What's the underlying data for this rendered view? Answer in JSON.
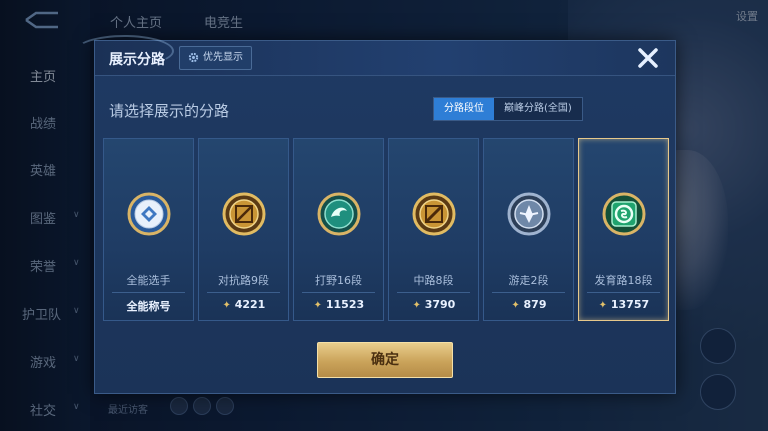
{
  "background": {
    "nav": [
      {
        "label": "主页",
        "active": true,
        "chevron": false
      },
      {
        "label": "战绩",
        "active": false,
        "chevron": false
      },
      {
        "label": "英雄",
        "active": false,
        "chevron": false
      },
      {
        "label": "图鉴",
        "active": false,
        "chevron": true
      },
      {
        "label": "荣誉",
        "active": false,
        "chevron": true
      },
      {
        "label": "护卫队",
        "active": false,
        "chevron": true
      },
      {
        "label": "游戏",
        "active": false,
        "chevron": true
      },
      {
        "label": "社交",
        "active": false,
        "chevron": true
      }
    ],
    "top_tabs": [
      "个人主页",
      "电竞生"
    ],
    "top_right": "设置",
    "recent_visitors": "最近访客"
  },
  "modal": {
    "title": "展示分路",
    "priority_button": "优先显示",
    "subtitle": "请选择展示的分路",
    "segments": [
      {
        "label": "分路段位",
        "active": true
      },
      {
        "label": "巅峰分路(全国)",
        "active": false
      }
    ],
    "cards": [
      {
        "name": "全能选手",
        "score": "全能称号",
        "has_score_icon": false,
        "emblem": "allround-emblem-icon",
        "selected": false
      },
      {
        "name": "对抗路9段",
        "score": "4221",
        "has_score_icon": true,
        "emblem": "clash-lane-emblem-icon",
        "selected": false
      },
      {
        "name": "打野16段",
        "score": "11523",
        "has_score_icon": true,
        "emblem": "jungle-emblem-icon",
        "selected": false
      },
      {
        "name": "中路8段",
        "score": "3790",
        "has_score_icon": true,
        "emblem": "mid-lane-emblem-icon",
        "selected": false
      },
      {
        "name": "游走2段",
        "score": "879",
        "has_score_icon": true,
        "emblem": "roam-emblem-icon",
        "selected": false
      },
      {
        "name": "发育路18段",
        "score": "13757",
        "has_score_icon": true,
        "emblem": "farm-lane-emblem-icon",
        "selected": true
      }
    ],
    "confirm_label": "确定"
  },
  "colors": {
    "accent_blue": "#2e7ed6",
    "gold": "#e6c88b",
    "panel": "#1f3a63"
  }
}
